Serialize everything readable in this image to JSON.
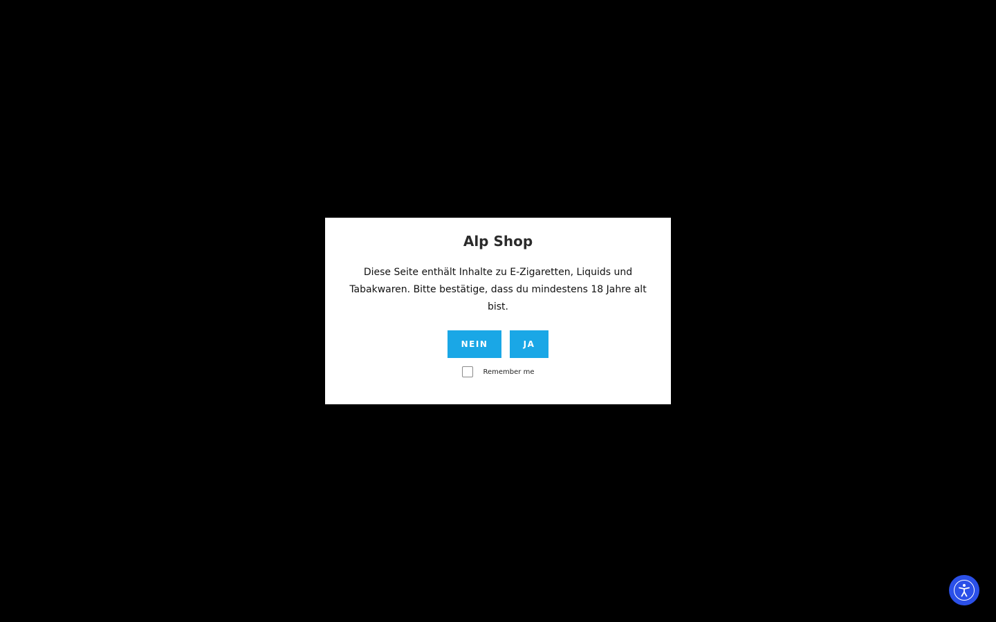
{
  "modal": {
    "title": "Alp Shop",
    "message": "Diese Seite enthält Inhalte zu E-Zigaretten, Liquids und Tabakwaren. Bitte bestätige, dass du mindestens 18 Jahre alt bist.",
    "no_label": "NEIN",
    "yes_label": "JA",
    "remember_label": "Remember me",
    "remember_checked": false
  },
  "accessibility": {
    "icon": "accessibility-person-icon"
  },
  "colors": {
    "background": "#000000",
    "modal_bg": "#ffffff",
    "button_bg": "#1aa7e6",
    "accessibility_bg": "#2b50e8"
  }
}
